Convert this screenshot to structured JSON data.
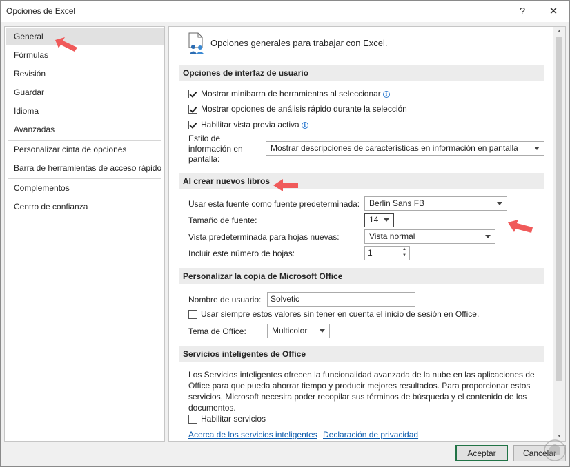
{
  "window": {
    "title": "Opciones de Excel",
    "help_icon": "?",
    "close_icon": "✕"
  },
  "nav": {
    "items": [
      {
        "label": "General",
        "active": true
      },
      {
        "label": "Fórmulas"
      },
      {
        "label": "Revisión"
      },
      {
        "label": "Guardar"
      },
      {
        "label": "Idioma"
      },
      {
        "label": "Avanzadas"
      },
      {
        "label": "Personalizar cinta de opciones"
      },
      {
        "label": "Barra de herramientas de acceso rápido"
      },
      {
        "label": "Complementos"
      },
      {
        "label": "Centro de confianza"
      }
    ]
  },
  "header": {
    "text": "Opciones generales para trabajar con Excel."
  },
  "ui_options": {
    "section_title": "Opciones de interfaz de usuario",
    "minibar_label": "Mostrar minibarra de herramientas al seleccionar",
    "quick_analysis_label": "Mostrar opciones de análisis rápido durante la selección",
    "live_preview_label": "Habilitar vista previa activa",
    "tooltip_style_label": "Estilo de información en pantalla:",
    "tooltip_style_label_lines": [
      "Estilo de",
      "información en",
      "pantalla:"
    ],
    "tooltip_style_value": "Mostrar descripciones de características en información en pantalla",
    "info_glyph": "i"
  },
  "new_workbooks": {
    "section_title": "Al crear nuevos libros",
    "font_label": "Usar esta fuente como fuente predeterminada:",
    "font_value": "Berlin Sans FB",
    "size_label": "Tamaño de fuente:",
    "size_value": "14",
    "view_label": "Vista predeterminada para hojas nuevas:",
    "view_value": "Vista normal",
    "sheets_label": "Incluir este número de hojas:",
    "sheets_value": "1"
  },
  "personalize": {
    "section_title": "Personalizar la copia de Microsoft Office",
    "username_label": "Nombre de usuario:",
    "username_value": "Solvetic",
    "always_use_label": "Usar siempre estos valores sin tener en cuenta el inicio de sesión en Office.",
    "theme_label": "Tema de Office:",
    "theme_value": "Multicolor"
  },
  "intelligent": {
    "section_title": "Servicios inteligentes de Office",
    "description": "Los Servicios inteligentes ofrecen la funcionalidad avanzada de la nube en las aplicaciones de Office para que pueda ahorrar tiempo y producir mejores resultados. Para proporcionar estos servicios, Microsoft necesita poder recopilar sus términos de búsqueda y el contenido de los documentos.",
    "enable_label": "Habilitar servicios",
    "about_link": "Acerca de los servicios inteligentes",
    "privacy_link": "Declaración de privacidad"
  },
  "footer": {
    "accept_label": "Aceptar",
    "cancel_label": "Cancelar"
  },
  "colors": {
    "accent_green": "#217346",
    "annotation_arrow": "#f05a5a",
    "link": "#0e5cad"
  }
}
